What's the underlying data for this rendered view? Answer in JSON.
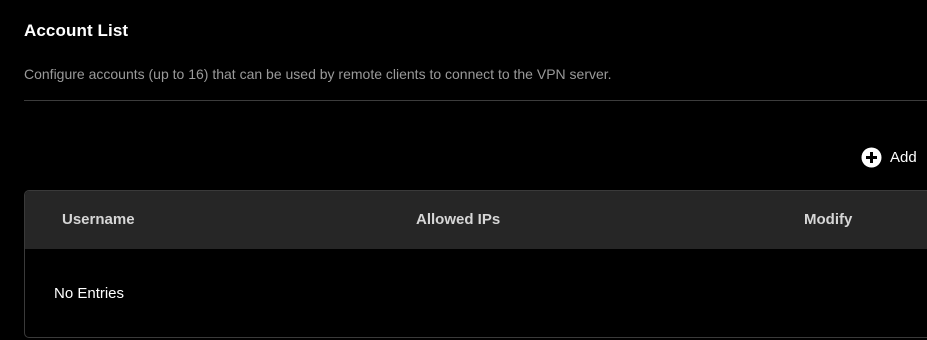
{
  "section": {
    "title": "Account List",
    "description": "Configure accounts (up to 16) that can be used by remote clients to connect to the VPN server."
  },
  "toolbar": {
    "add_icon": "plus-circle-icon",
    "add_label": "Add"
  },
  "table": {
    "columns": [
      "Username",
      "Allowed IPs",
      "Modify"
    ],
    "rows": [],
    "empty_message": "No Entries"
  },
  "colors": {
    "background": "#000000",
    "header_background": "#262626",
    "description_text": "#9a9a9a",
    "border": "#3a3a3a"
  }
}
